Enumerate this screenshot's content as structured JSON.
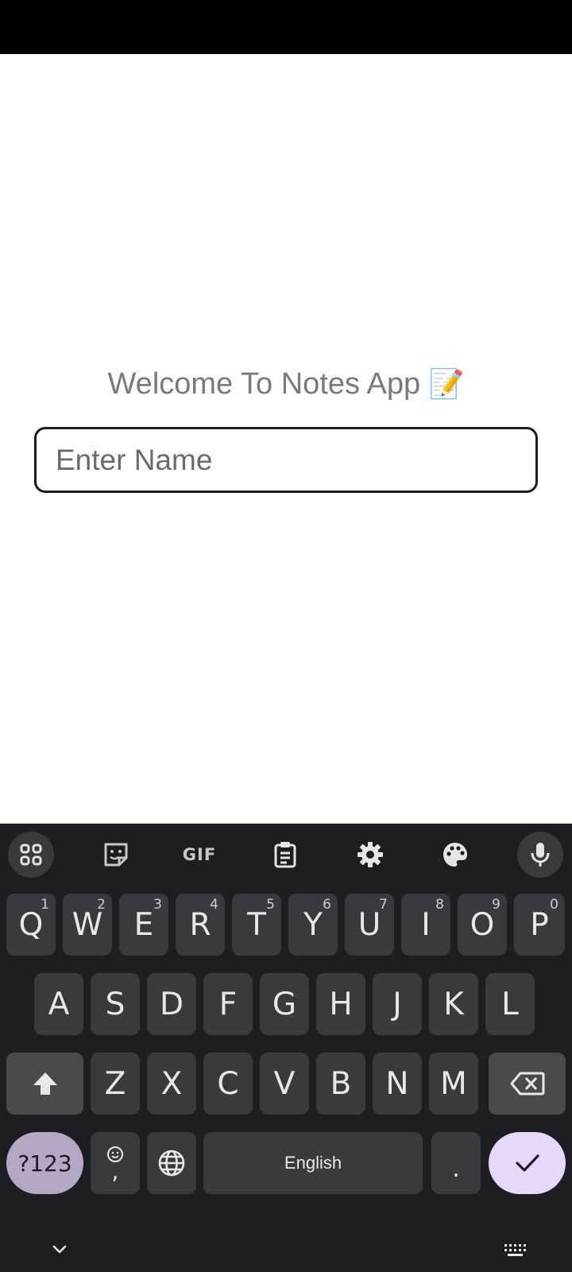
{
  "app": {
    "welcome_text": "Welcome To Notes App",
    "welcome_emoji": "📝",
    "name_input": {
      "placeholder": "Enter Name",
      "value": ""
    }
  },
  "keyboard": {
    "toolbar": {
      "apps_icon": "grid-icon",
      "sticker_icon": "sticker-icon",
      "gif_label": "GIF",
      "clipboard_icon": "clipboard-icon",
      "settings_icon": "gear-icon",
      "theme_icon": "palette-icon",
      "mic_icon": "microphone-icon"
    },
    "row1": [
      {
        "label": "Q",
        "hint": "1"
      },
      {
        "label": "W",
        "hint": "2"
      },
      {
        "label": "E",
        "hint": "3"
      },
      {
        "label": "R",
        "hint": "4"
      },
      {
        "label": "T",
        "hint": "5"
      },
      {
        "label": "Y",
        "hint": "6"
      },
      {
        "label": "U",
        "hint": "7"
      },
      {
        "label": "I",
        "hint": "8"
      },
      {
        "label": "O",
        "hint": "9"
      },
      {
        "label": "P",
        "hint": "0"
      }
    ],
    "row2": [
      "A",
      "S",
      "D",
      "F",
      "G",
      "H",
      "J",
      "K",
      "L"
    ],
    "row3": [
      "Z",
      "X",
      "C",
      "V",
      "B",
      "N",
      "M"
    ],
    "symbols_label": "?123",
    "comma_label": ",",
    "space_label": "English",
    "period_label": ".",
    "colors": {
      "background": "#1e1d22",
      "key": "#3a393f",
      "function_key": "#4a4950",
      "symbols_key": "#b5a8c4",
      "enter_key": "#e6d8fb"
    }
  }
}
